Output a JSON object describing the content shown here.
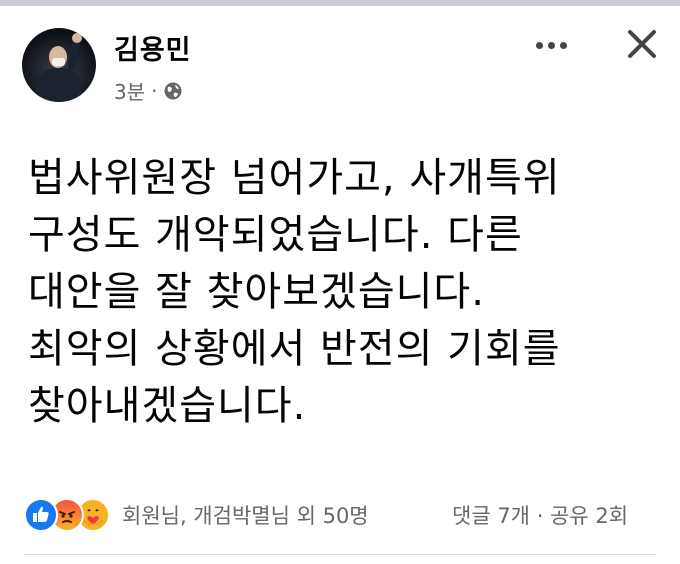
{
  "post": {
    "author": "김용민",
    "time": "3분",
    "dot": "·",
    "lines": [
      "법사위원장 넘어가고, 사개특위",
      "구성도 개악되었습니다. 다른",
      "대안을 잘 찾아보겠습니다.",
      "최악의 상황에서 반전의 기회를",
      "찾아내겠습니다."
    ],
    "privacy_icon": "globe-icon"
  },
  "reactions": {
    "icons": [
      "like-icon",
      "angry-icon",
      "care-icon"
    ],
    "summary": "회원님, 개검박멸님 외 50명",
    "comments": "댓글 7개",
    "separator": "·",
    "shares": "공유 2회"
  },
  "colors": {
    "like": "#1877f2",
    "secondary_text": "#65676b"
  }
}
